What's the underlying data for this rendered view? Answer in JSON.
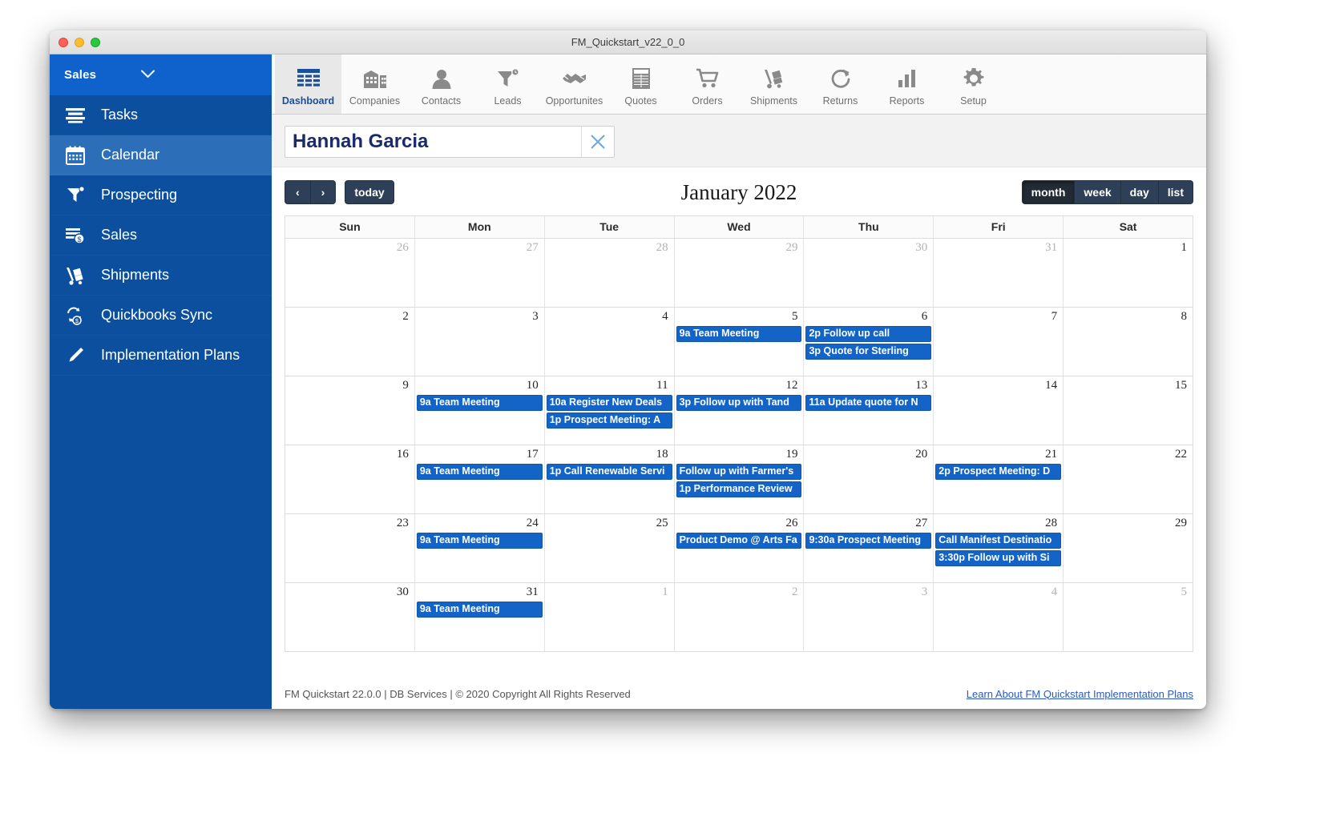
{
  "window": {
    "title": "FM_Quickstart_v22_0_0"
  },
  "sidebar": {
    "header": {
      "label": "Sales",
      "chevron": "chevron-down-icon"
    },
    "items": [
      {
        "label": "Tasks",
        "icon": "tasks-icon",
        "active": false
      },
      {
        "label": "Calendar",
        "icon": "calendar-icon",
        "active": true
      },
      {
        "label": "Prospecting",
        "icon": "funnel-icon",
        "active": false
      },
      {
        "label": "Sales",
        "icon": "sales-dollar-icon",
        "active": false
      },
      {
        "label": "Shipments",
        "icon": "hand-truck-icon",
        "active": false
      },
      {
        "label": "Quickbooks Sync",
        "icon": "quickbooks-sync-icon",
        "active": false
      },
      {
        "label": "Implementation Plans",
        "icon": "pen-icon",
        "active": false
      }
    ]
  },
  "toolbar": {
    "items": [
      {
        "label": "Dashboard",
        "icon": "dashboard-icon",
        "active": true
      },
      {
        "label": "Companies",
        "icon": "buildings-icon",
        "active": false
      },
      {
        "label": "Contacts",
        "icon": "person-icon",
        "active": false
      },
      {
        "label": "Leads",
        "icon": "funnel-clock-icon",
        "active": false
      },
      {
        "label": "Opportunites",
        "icon": "handshake-icon",
        "active": false
      },
      {
        "label": "Quotes",
        "icon": "document-table-icon",
        "active": false
      },
      {
        "label": "Orders",
        "icon": "shopping-cart-icon",
        "active": false
      },
      {
        "label": "Shipments",
        "icon": "hand-truck-icon",
        "active": false
      },
      {
        "label": "Returns",
        "icon": "refresh-arrow-icon",
        "active": false
      },
      {
        "label": "Reports",
        "icon": "bar-chart-icon",
        "active": false
      },
      {
        "label": "Setup",
        "icon": "gear-icon",
        "active": false
      }
    ]
  },
  "search": {
    "value": "Hannah Garcia",
    "placeholder": "",
    "clear_icon": "close-x-icon"
  },
  "calendar": {
    "prev_label": "‹",
    "next_label": "›",
    "today_label": "today",
    "title": "January 2022",
    "views": [
      {
        "label": "month",
        "active": true
      },
      {
        "label": "week",
        "active": false
      },
      {
        "label": "day",
        "active": false
      },
      {
        "label": "list",
        "active": false
      }
    ],
    "day_headers": [
      "Sun",
      "Mon",
      "Tue",
      "Wed",
      "Thu",
      "Fri",
      "Sat"
    ],
    "weeks": [
      [
        {
          "num": "26",
          "other": true,
          "events": []
        },
        {
          "num": "27",
          "other": true,
          "events": []
        },
        {
          "num": "28",
          "other": true,
          "events": []
        },
        {
          "num": "29",
          "other": true,
          "events": []
        },
        {
          "num": "30",
          "other": true,
          "events": []
        },
        {
          "num": "31",
          "other": true,
          "events": []
        },
        {
          "num": "1",
          "other": false,
          "events": []
        }
      ],
      [
        {
          "num": "2",
          "other": false,
          "events": []
        },
        {
          "num": "3",
          "other": false,
          "events": []
        },
        {
          "num": "4",
          "other": false,
          "events": []
        },
        {
          "num": "5",
          "other": false,
          "events": [
            "9a Team Meeting"
          ]
        },
        {
          "num": "6",
          "other": false,
          "events": [
            "2p Follow up call",
            "3p Quote for Sterling"
          ]
        },
        {
          "num": "7",
          "other": false,
          "events": []
        },
        {
          "num": "8",
          "other": false,
          "events": []
        }
      ],
      [
        {
          "num": "9",
          "other": false,
          "events": []
        },
        {
          "num": "10",
          "other": false,
          "events": [
            "9a Team Meeting"
          ]
        },
        {
          "num": "11",
          "other": false,
          "events": [
            "10a Register New Deals",
            "1p Prospect Meeting: A"
          ]
        },
        {
          "num": "12",
          "other": false,
          "events": [
            "3p Follow up with Tand"
          ]
        },
        {
          "num": "13",
          "other": false,
          "events": [
            "11a Update quote for N"
          ]
        },
        {
          "num": "14",
          "other": false,
          "events": []
        },
        {
          "num": "15",
          "other": false,
          "events": []
        }
      ],
      [
        {
          "num": "16",
          "other": false,
          "events": []
        },
        {
          "num": "17",
          "other": false,
          "events": [
            "9a Team Meeting"
          ]
        },
        {
          "num": "18",
          "other": false,
          "events": [
            "1p Call Renewable Servi"
          ]
        },
        {
          "num": "19",
          "other": false,
          "events": [
            "Follow up with Farmer's",
            "1p Performance Review"
          ]
        },
        {
          "num": "20",
          "other": false,
          "events": []
        },
        {
          "num": "21",
          "other": false,
          "events": [
            "2p Prospect Meeting: D"
          ]
        },
        {
          "num": "22",
          "other": false,
          "events": []
        }
      ],
      [
        {
          "num": "23",
          "other": false,
          "events": []
        },
        {
          "num": "24",
          "other": false,
          "events": [
            "9a Team Meeting"
          ]
        },
        {
          "num": "25",
          "other": false,
          "events": []
        },
        {
          "num": "26",
          "other": false,
          "events": [
            "Product Demo @ Arts Fa"
          ]
        },
        {
          "num": "27",
          "other": false,
          "events": [
            "9:30a Prospect Meeting"
          ]
        },
        {
          "num": "28",
          "other": false,
          "events": [
            "Call Manifest Destinatio",
            "3:30p Follow up with Si"
          ]
        },
        {
          "num": "29",
          "other": false,
          "events": []
        }
      ],
      [
        {
          "num": "30",
          "other": false,
          "events": []
        },
        {
          "num": "31",
          "other": false,
          "events": [
            "9a Team Meeting"
          ]
        },
        {
          "num": "1",
          "other": true,
          "events": []
        },
        {
          "num": "2",
          "other": true,
          "events": []
        },
        {
          "num": "3",
          "other": true,
          "events": []
        },
        {
          "num": "4",
          "other": true,
          "events": []
        },
        {
          "num": "5",
          "other": true,
          "events": []
        }
      ]
    ]
  },
  "footer": {
    "copyright": "FM Quickstart 22.0.0  | DB Services | © 2020 Copyright All Rights Reserved",
    "link": "Learn About FM Quickstart Implementation Plans"
  },
  "colors": {
    "sidebar_bg": "#0b4f9e",
    "sidebar_header_bg": "#0f62cc",
    "sidebar_active_bg": "#2c6fb8",
    "event_blue": "#1464c8",
    "toolbar_active_text": "#1a4f9c",
    "fc_button": "#2e4057",
    "link": "#2a59c8"
  }
}
